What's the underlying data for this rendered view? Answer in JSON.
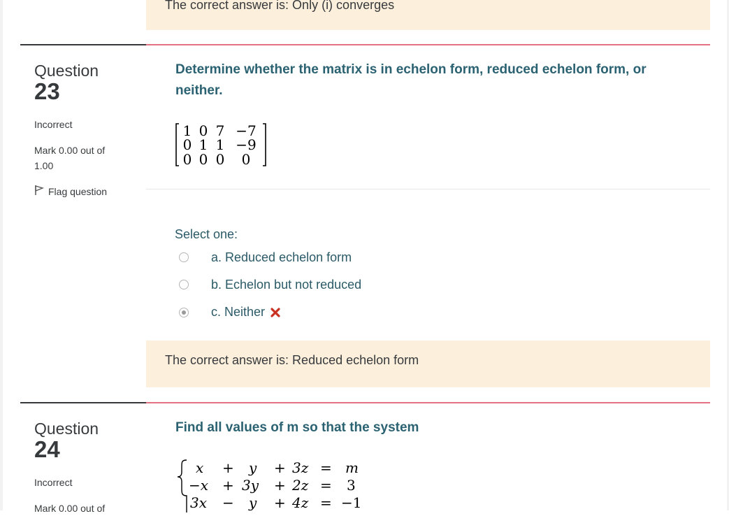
{
  "previous_feedback": {
    "text": "The correct answer is: Only (i) converges"
  },
  "q23": {
    "label": "Question",
    "number": "23",
    "state": "Incorrect",
    "grade": "Mark 0.00 out of 1.00",
    "flag_label": "Flag question",
    "text": "Determine whether the matrix is in echelon form, reduced echelon form, or neither.",
    "matrix": [
      [
        "1",
        "0",
        "7",
        "−7"
      ],
      [
        "0",
        "1",
        "1",
        "−9"
      ],
      [
        "0",
        "0",
        "0",
        "0"
      ]
    ],
    "prompt": "Select one:",
    "options": [
      {
        "label": "a. Reduced echelon form",
        "selected": false
      },
      {
        "label": "b. Echelon but not reduced",
        "selected": false
      },
      {
        "label": "c. Neither",
        "selected": true,
        "mark": "incorrect-x-icon"
      }
    ],
    "feedback": "The correct answer is: Reduced echelon form"
  },
  "q24": {
    "label": "Question",
    "number": "24",
    "state": "Incorrect",
    "grade": "Mark 0.00 out of",
    "text": "Find all values of m so that the system",
    "system": [
      {
        "t1": "x",
        "t2": "y",
        "t3": "3z",
        "rhs": "m"
      },
      {
        "t1": "−x",
        "t2": "3y",
        "t3": "2z",
        "rhs": "3"
      },
      {
        "t1": "3x",
        "t2": "y",
        "t3": "4z",
        "rhs": "−1"
      }
    ]
  },
  "colors": {
    "accent_text": "#2b6272",
    "rule": "#e4717f",
    "feedback_bg": "#fcefdc",
    "error": "#ca3120"
  }
}
